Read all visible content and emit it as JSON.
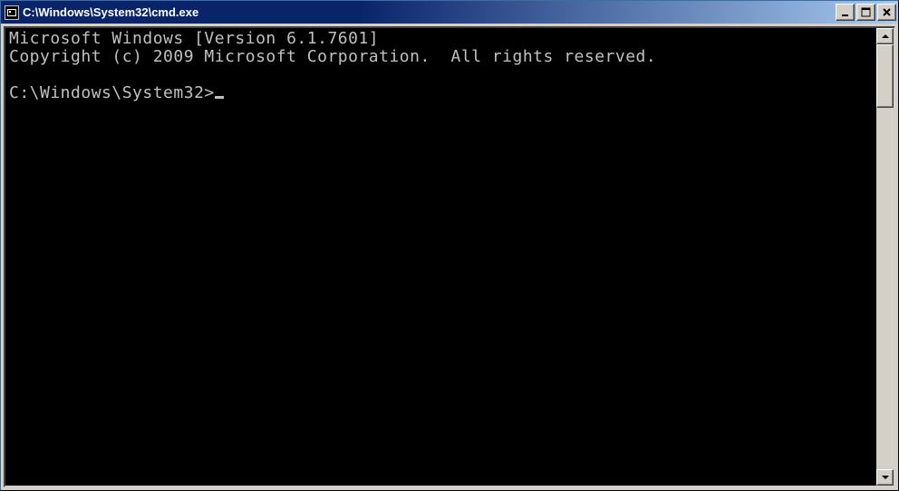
{
  "window": {
    "title": "C:\\Windows\\System32\\cmd.exe"
  },
  "terminal": {
    "line1": "Microsoft Windows [Version 6.1.7601]",
    "line2": "Copyright (c) 2009 Microsoft Corporation.  All rights reserved.",
    "blank": "",
    "prompt": "C:\\Windows\\System32>"
  }
}
